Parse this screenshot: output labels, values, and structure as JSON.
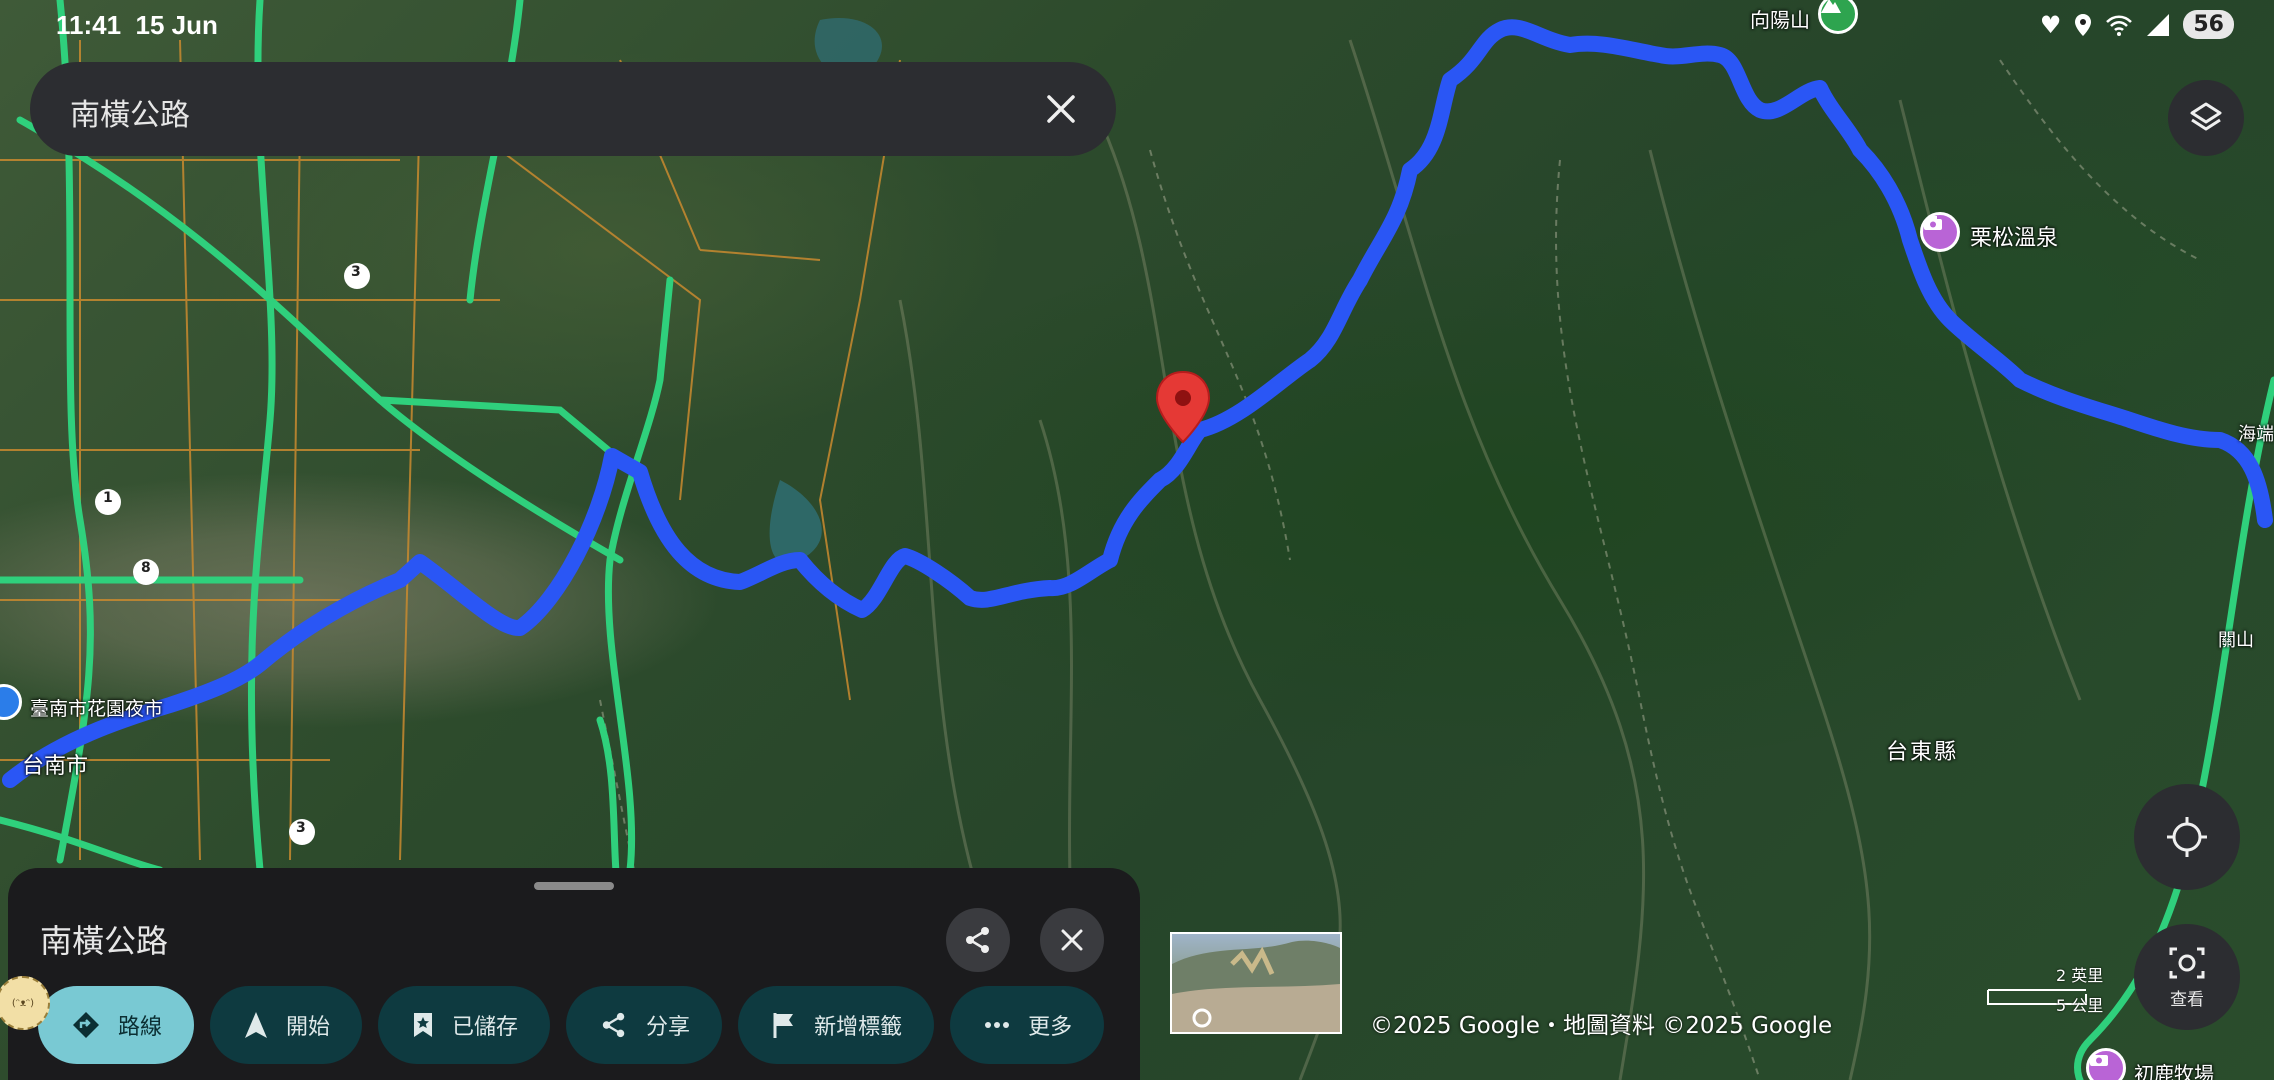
{
  "status_bar": {
    "time": "11:41",
    "date": "15 Jun",
    "battery": "56"
  },
  "search": {
    "query": "南橫公路"
  },
  "map": {
    "labels": {
      "xiangyang_mountain": "向陽山",
      "lisong_hot_spring": "栗松溫泉",
      "haiduan": "海端",
      "guanshan": "關山",
      "taitung_county": "台東縣",
      "tainan_night_market": "臺南市花園夜市",
      "tainan_city": "台南市",
      "chulu_ranch": "初鹿牧場",
      "road_3_top": "3",
      "road_3_bottom": "3",
      "road_1": "1",
      "road_8": "8"
    },
    "copyright": "©2025 Google・地圖資料 ©2025 Google",
    "scale": {
      "miles": "2 英里",
      "km": "5 公里"
    },
    "route_color": "#2a56f5",
    "highway_color": "#2fd07c",
    "marker_color": "#e53935"
  },
  "controls": {
    "lens_label": "查看"
  },
  "sheet": {
    "title": "南橫公路",
    "chips": [
      {
        "label": "路線",
        "icon": "directions-icon"
      },
      {
        "label": "開始",
        "icon": "navigation-arrow-icon"
      },
      {
        "label": "已儲存",
        "icon": "bookmark-icon"
      },
      {
        "label": "分享",
        "icon": "share-icon"
      },
      {
        "label": "新增標籤",
        "icon": "flag-icon"
      },
      {
        "label": "更多",
        "icon": "more-icon"
      }
    ]
  }
}
